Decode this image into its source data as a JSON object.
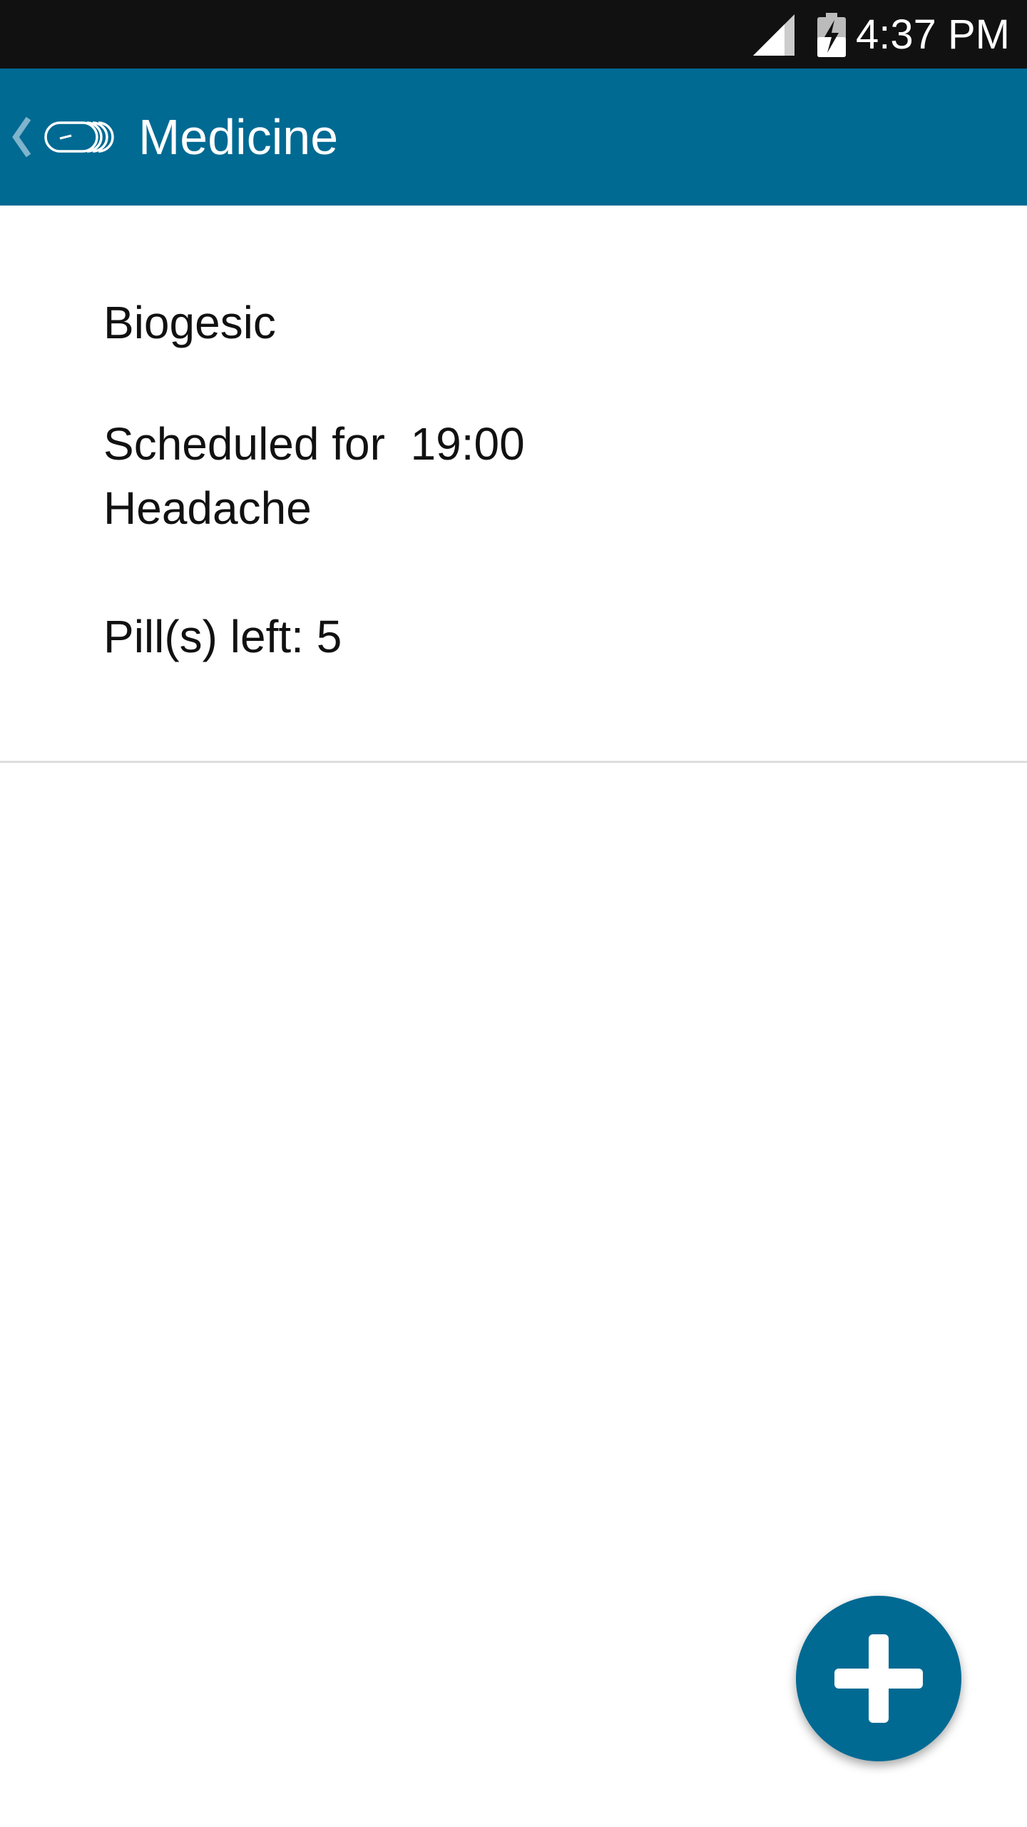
{
  "status_bar": {
    "time": "4:37 PM",
    "signal_icon": "signal-icon",
    "battery_icon": "battery-charging-icon"
  },
  "app_bar": {
    "title": "Medicine",
    "back_icon": "back-chevron-icon",
    "logo_icon": "pill-logo-icon",
    "color": "#006a93"
  },
  "medicines": [
    {
      "name": "Biogesic",
      "schedule": "Scheduled for  19:00",
      "note": "Headache",
      "pills_left": "Pill(s) left: 5"
    }
  ],
  "fab": {
    "icon": "plus-icon",
    "color": "#006a93"
  }
}
